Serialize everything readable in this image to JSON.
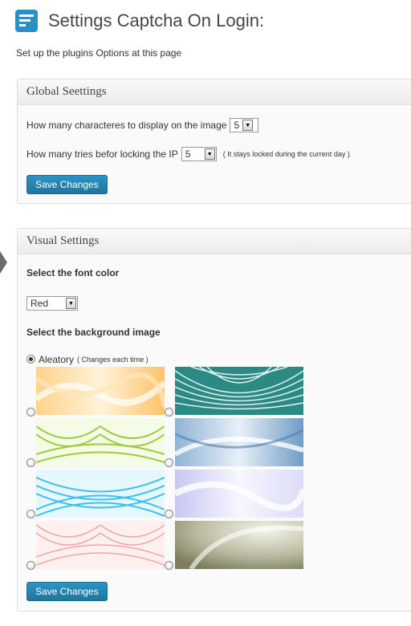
{
  "header": {
    "title": "Settings Captcha On Login:",
    "icon": "settings-logo-icon"
  },
  "subtitle": "Set up the plugins Options at this page",
  "global": {
    "title": "Global Seettings",
    "chars_label": "How many characteres to display on the image",
    "chars_value": "5",
    "tries_label": "How many tries befor locking the IP",
    "tries_value": "5",
    "tries_note": "( It stays locked during the current day )",
    "save_label": "Save Changes"
  },
  "visual": {
    "title": "Visual Settings",
    "font_color_label": "Select the font color",
    "font_color_value": "Red",
    "bg_label": "Select the background image",
    "aleatory_label": "Aleatory",
    "aleatory_note": "( Changes each time )",
    "save_label": "Save Changes"
  },
  "colors": {
    "accent": "#21759b",
    "panel_bg": "#fafafa",
    "border": "#dcdcdc"
  }
}
